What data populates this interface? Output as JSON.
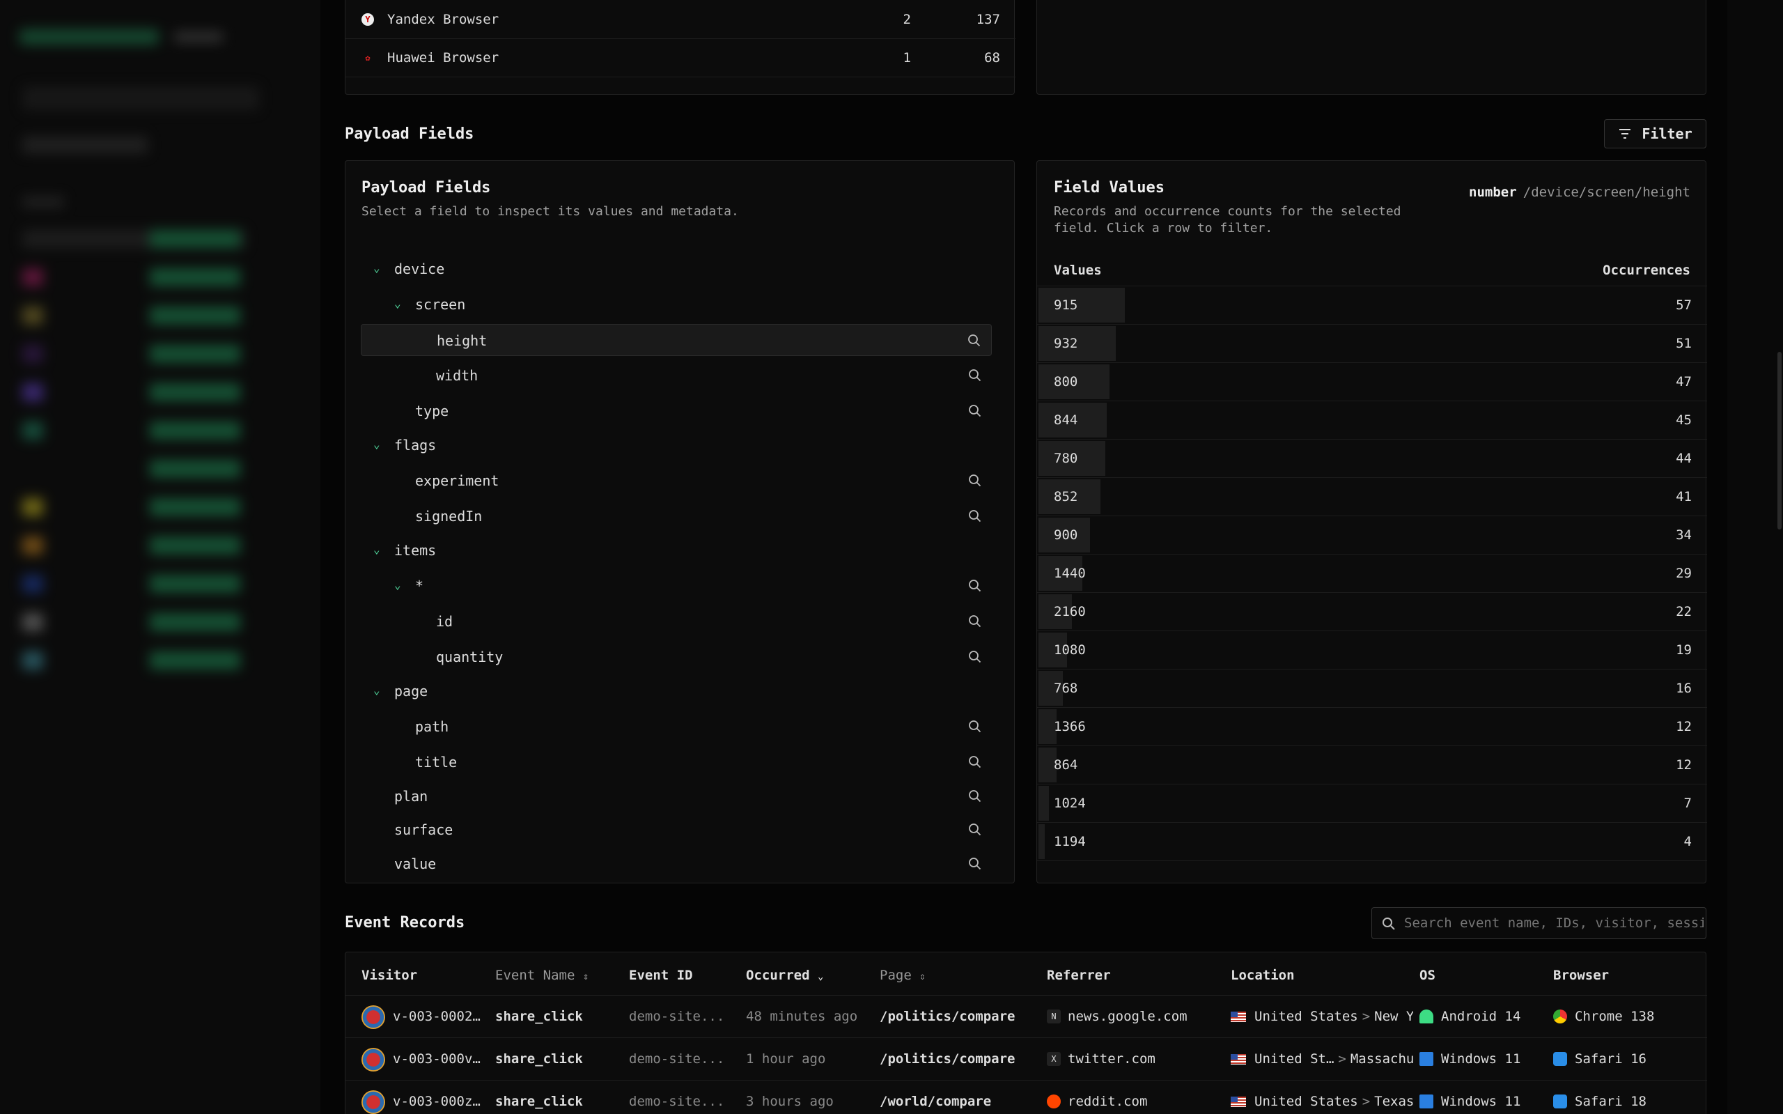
{
  "browsers_top": {
    "rows": [
      {
        "name": "Yandex Browser",
        "count": "2",
        "total": "137",
        "icon": "yandex-icon"
      },
      {
        "name": "Huawei Browser",
        "count": "1",
        "total": "68",
        "icon": "huawei-icon"
      }
    ]
  },
  "payload_section": {
    "title": "Payload Fields",
    "filter_label": "Filter"
  },
  "payload_fields": {
    "title": "Payload Fields",
    "subtitle": "Select a field to inspect its values and metadata.",
    "tree": [
      {
        "label": "device",
        "level": 0,
        "expanded": true,
        "searchable": false
      },
      {
        "label": "screen",
        "level": 1,
        "expanded": true,
        "searchable": false
      },
      {
        "label": "height",
        "level": 2,
        "selected": true,
        "searchable": true
      },
      {
        "label": "width",
        "level": 2,
        "searchable": true
      },
      {
        "label": "type",
        "level": 1,
        "searchable": true
      },
      {
        "label": "flags",
        "level": 0,
        "expanded": true,
        "searchable": false
      },
      {
        "label": "experiment",
        "level": 1,
        "searchable": true
      },
      {
        "label": "signedIn",
        "level": 1,
        "searchable": true
      },
      {
        "label": "items",
        "level": 0,
        "expanded": true,
        "searchable": false
      },
      {
        "label": "*",
        "level": 1,
        "expanded": true,
        "searchable": true
      },
      {
        "label": "id",
        "level": 2,
        "searchable": true
      },
      {
        "label": "quantity",
        "level": 2,
        "searchable": true
      },
      {
        "label": "page",
        "level": 0,
        "expanded": true,
        "searchable": false
      },
      {
        "label": "path",
        "level": 1,
        "searchable": true
      },
      {
        "label": "title",
        "level": 1,
        "searchable": true
      },
      {
        "label": "plan",
        "level": 0,
        "searchable": true
      },
      {
        "label": "surface",
        "level": 0,
        "searchable": true
      },
      {
        "label": "value",
        "level": 0,
        "searchable": true
      }
    ]
  },
  "field_values": {
    "title": "Field Values",
    "subtitle_line1": "Records and occurrence counts for the selected",
    "subtitle_line2": "field. Click a row to filter.",
    "type": "number",
    "path": "/device/screen/height",
    "col_values": "Values",
    "col_occurrences": "Occurrences",
    "rows": [
      {
        "value": "915",
        "count": "57",
        "fraction": 1.0
      },
      {
        "value": "932",
        "count": "51",
        "fraction": 0.895
      },
      {
        "value": "800",
        "count": "47",
        "fraction": 0.825
      },
      {
        "value": "844",
        "count": "45",
        "fraction": 0.789
      },
      {
        "value": "780",
        "count": "44",
        "fraction": 0.772
      },
      {
        "value": "852",
        "count": "41",
        "fraction": 0.719
      },
      {
        "value": "900",
        "count": "34",
        "fraction": 0.596
      },
      {
        "value": "1440",
        "count": "29",
        "fraction": 0.509
      },
      {
        "value": "2160",
        "count": "22",
        "fraction": 0.386
      },
      {
        "value": "1080",
        "count": "19",
        "fraction": 0.333
      },
      {
        "value": "768",
        "count": "16",
        "fraction": 0.281
      },
      {
        "value": "1366",
        "count": "12",
        "fraction": 0.211
      },
      {
        "value": "864",
        "count": "12",
        "fraction": 0.211
      },
      {
        "value": "1024",
        "count": "7",
        "fraction": 0.123
      },
      {
        "value": "1194",
        "count": "4",
        "fraction": 0.07
      }
    ]
  },
  "event_records": {
    "title": "Event Records",
    "search_placeholder": "Search event name, IDs, visitor, session",
    "columns": {
      "visitor": "Visitor",
      "event_name": "Event Name",
      "event_id": "Event ID",
      "occurred": "Occurred",
      "page": "Page",
      "referrer": "Referrer",
      "location": "Location",
      "os": "OS",
      "browser": "Browser"
    },
    "rows": [
      {
        "visitor": "v-003-0002…",
        "event": "share_click",
        "event_id": "demo-site...",
        "occurred": "48 minutes ago",
        "page": "/politics/compare",
        "referrer": "news.google.com",
        "referrer_icon": "google-news-icon",
        "country": "United States",
        "region": "New York",
        "os": "Android 14",
        "os_icon": "android-icon",
        "browser": "Chrome 138",
        "browser_icon": "chrome-icon"
      },
      {
        "visitor": "v-003-000v…",
        "event": "share_click",
        "event_id": "demo-site...",
        "occurred": "1 hour ago",
        "page": "/politics/compare",
        "referrer": "twitter.com",
        "referrer_icon": "x-icon",
        "country": "United St…",
        "region": "Massachuset",
        "os": "Windows 11",
        "os_icon": "windows-icon",
        "browser": "Safari 16",
        "browser_icon": "safari-icon"
      },
      {
        "visitor": "v-003-000z…",
        "event": "share_click",
        "event_id": "demo-site...",
        "occurred": "3 hours ago",
        "page": "/world/compare",
        "referrer": "reddit.com",
        "referrer_icon": "reddit-icon",
        "country": "United States",
        "region": "Texas",
        "os": "Windows 11",
        "os_icon": "windows-icon",
        "browser": "Safari 18",
        "browser_icon": "safari-icon"
      }
    ]
  },
  "colors": {
    "accent_green": "#4fd39a",
    "background": "#050505",
    "card": "#0c0c0c"
  }
}
